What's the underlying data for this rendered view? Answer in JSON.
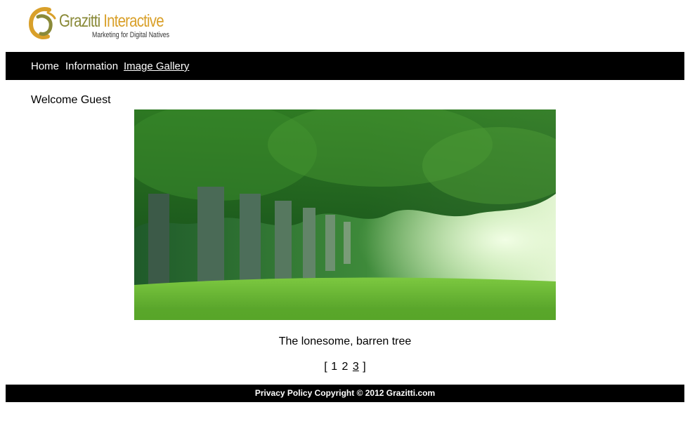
{
  "logo": {
    "brand_part1": "Grazitti",
    "brand_part2": "Interactive",
    "tagline": "Marketing for Digital Natives"
  },
  "nav": {
    "items": [
      {
        "label": "Home",
        "active": false
      },
      {
        "label": "Information",
        "active": false
      },
      {
        "label": "Image Gallery",
        "active": true
      }
    ]
  },
  "welcome": "Welcome Guest",
  "gallery": {
    "caption": "The lonesome, barren tree",
    "pager": {
      "open": "[",
      "pages": [
        "1",
        "2",
        "3"
      ],
      "current": "3",
      "close": "]"
    }
  },
  "footer": {
    "text": "Privacy Policy Copyright © 2012 Grazitti.com"
  },
  "colors": {
    "nav_bg": "#000000",
    "brand_olive": "#8a8a39",
    "brand_orange": "#d9a02a"
  }
}
